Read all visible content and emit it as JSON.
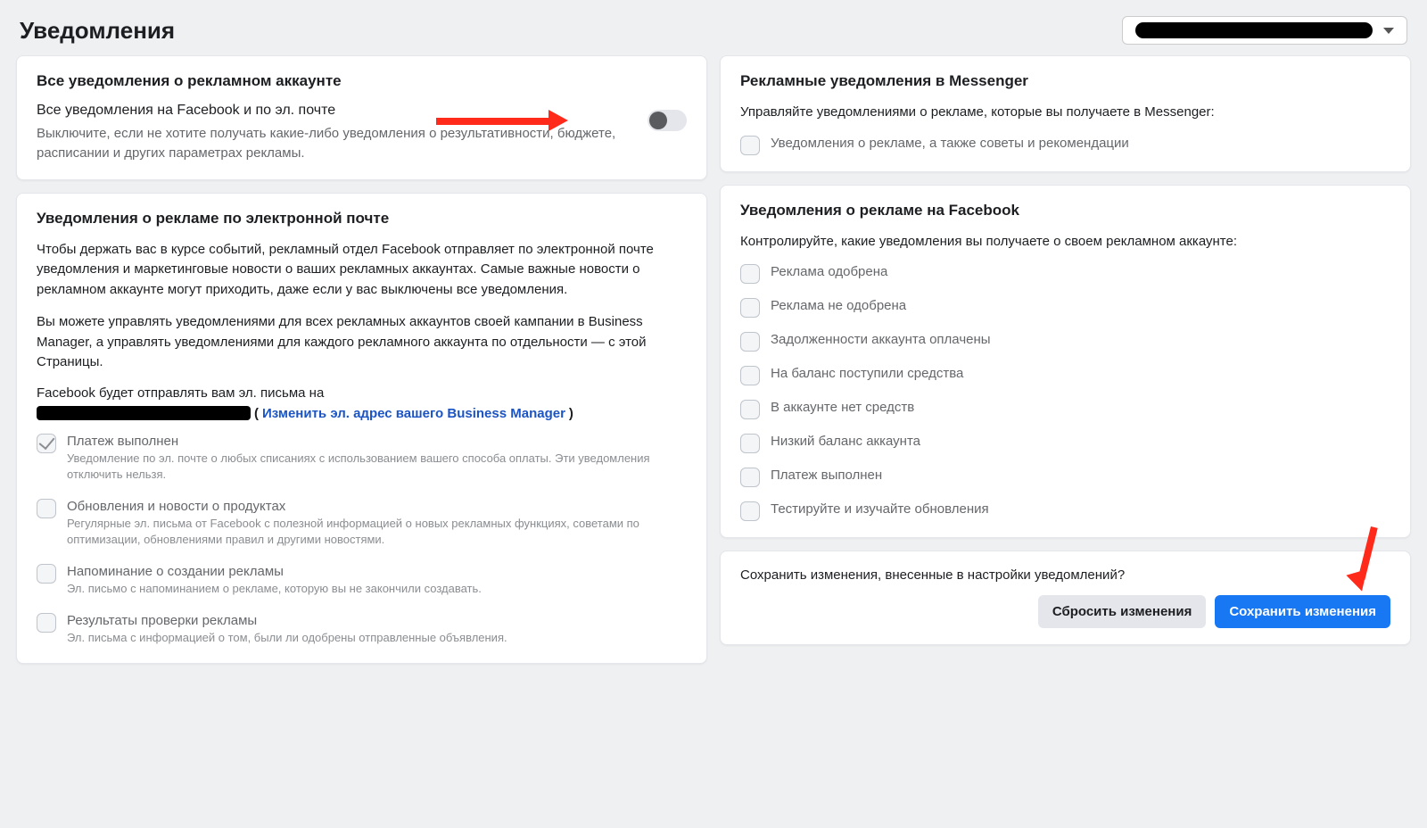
{
  "header": {
    "title": "Уведомления"
  },
  "account_selector": {
    "name_redacted": true
  },
  "cards": {
    "all_notifications": {
      "title": "Все уведомления о рекламном аккаунте",
      "subhead": "Все уведомления на Facebook и по эл. почте",
      "desc": "Выключите, если не хотите получать какие-либо уведомления о результативности, бюджете, расписании и других параметрах рекламы.",
      "toggle_on": false
    },
    "email_ads": {
      "title": "Уведомления о рекламе по электронной почте",
      "para1": "Чтобы держать вас в курсе событий, рекламный отдел Facebook отправляет по электронной почте уведомления и маркетинговые новости о ваших рекламных аккаунтах. Самые важные новости о рекламном аккаунте могут приходить, даже если у вас выключены все уведомления.",
      "para2": "Вы можете управлять уведомлениями для всех рекламных аккаунтов своей кампании в Business Manager, а управлять уведомлениями для каждого рекламного аккаунта по отдельности — с этой Страницы.",
      "email_prefix": "Facebook будет отправлять вам эл. письма на",
      "email_open": "(",
      "email_link": "Изменить эл. адрес вашего Business Manager",
      "email_close": ")",
      "items": [
        {
          "label": "Платеж выполнен",
          "sub": "Уведомление по эл. почте о любых списаниях с использованием вашего способа оплаты. Эти уведомления отключить нельзя.",
          "checked": true,
          "locked": true
        },
        {
          "label": "Обновления и новости о продуктах",
          "sub": "Регулярные эл. письма от Facebook с полезной информацией о новых рекламных функциях, советами по оптимизации, обновлениями правил и другими новостями.",
          "checked": false
        },
        {
          "label": "Напоминание о создании рекламы",
          "sub": "Эл. письмо с напоминанием о рекламе, которую вы не закончили создавать.",
          "checked": false
        },
        {
          "label": "Результаты проверки рекламы",
          "sub": "Эл. письма с информацией о том, были ли одобрены отправленные объявления.",
          "checked": false
        }
      ]
    },
    "messenger": {
      "title": "Рекламные уведомления в Messenger",
      "desc": "Управляйте уведомлениями о рекламе, которые вы получаете в Messenger:",
      "items": [
        {
          "label": "Уведомления о рекламе, а также советы и рекомендации",
          "checked": false
        }
      ]
    },
    "fb_ads": {
      "title": "Уведомления о рекламе на Facebook",
      "desc": "Контролируйте, какие уведомления вы получаете о своем рекламном аккаунте:",
      "items": [
        {
          "label": "Реклама одобрена"
        },
        {
          "label": "Реклама не одобрена"
        },
        {
          "label": "Задолженности аккаунта оплачены"
        },
        {
          "label": "На баланс поступили средства"
        },
        {
          "label": "В аккаунте нет средств"
        },
        {
          "label": "Низкий баланс аккаунта"
        },
        {
          "label": "Платеж выполнен"
        },
        {
          "label": "Тестируйте и изучайте обновления"
        }
      ]
    },
    "save": {
      "question": "Сохранить изменения, внесенные в настройки уведомлений?",
      "reset": "Сбросить изменения",
      "save": "Сохранить изменения"
    }
  }
}
